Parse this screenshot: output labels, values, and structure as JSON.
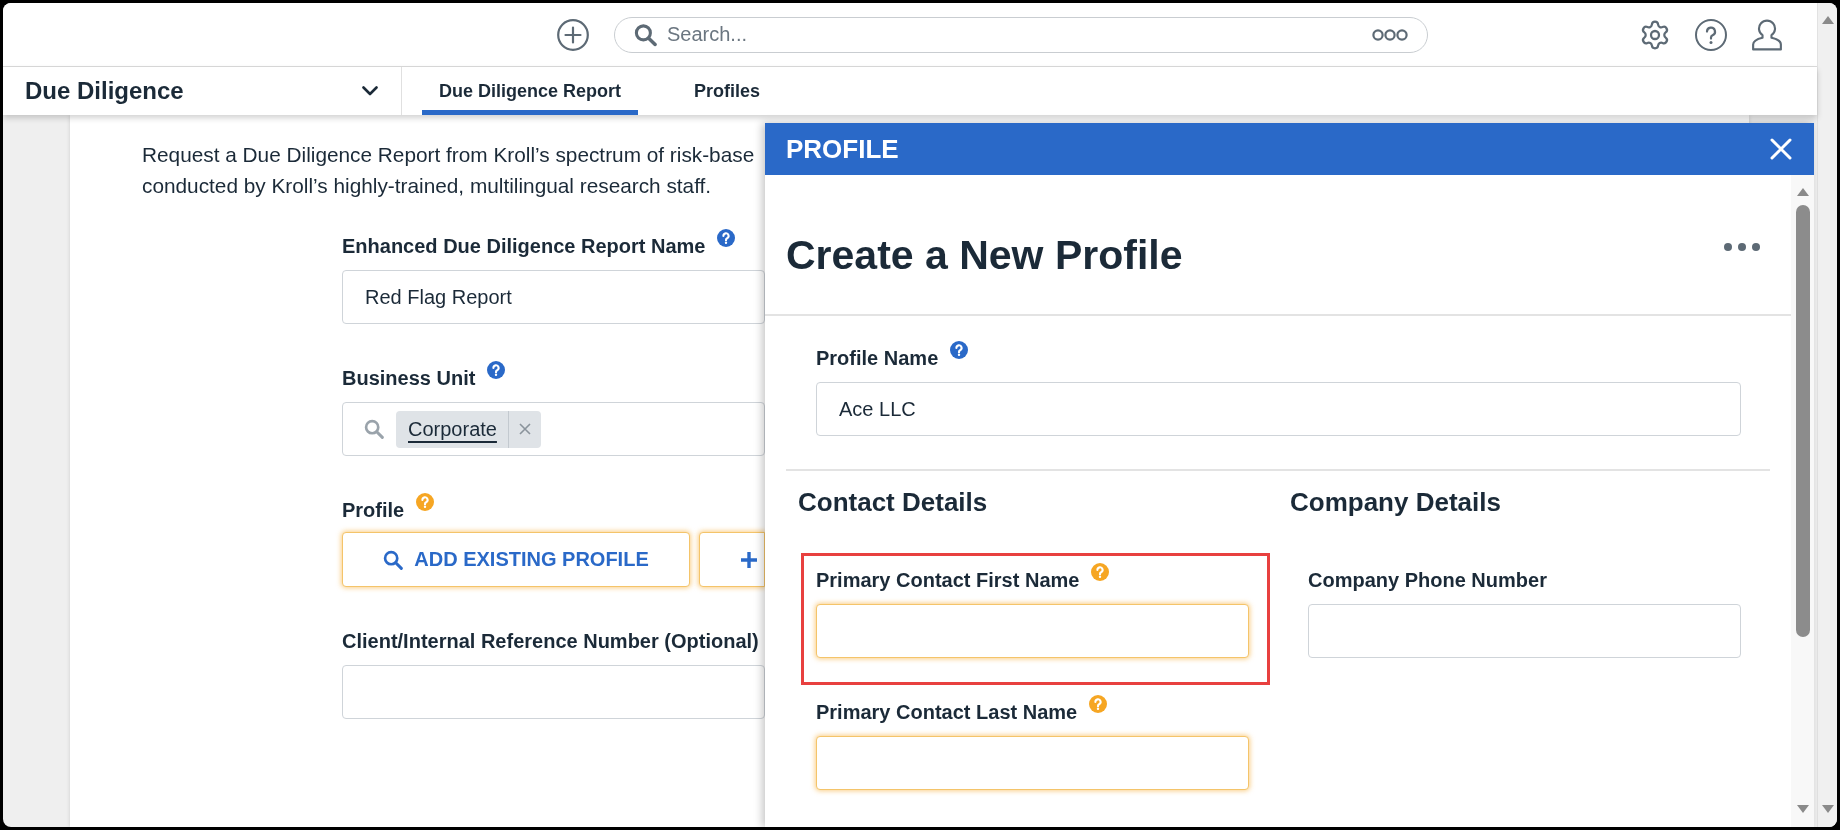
{
  "top_bar": {
    "search": {
      "placeholder": "Search..."
    }
  },
  "nav": {
    "app_name": "Due Diligence",
    "tabs": [
      {
        "label": "Due Diligence Report",
        "selected": true
      },
      {
        "label": "Profiles",
        "selected": false
      }
    ]
  },
  "page": {
    "description_lines": [
      "Request a Due Diligence Report from Kroll’s spectrum of risk-base",
      "conducted by Kroll’s highly-trained, multilingual research staff."
    ],
    "fields": [
      {
        "kind": "text",
        "label": "Enhanced Due Diligence Report Name",
        "help_icon": true,
        "warning": false,
        "value": "Red Flag Report"
      },
      {
        "kind": "tags",
        "label": "Business Unit",
        "help_icon": true,
        "warning": false,
        "tags": [
          "Corporate"
        ]
      },
      {
        "kind": "buttons",
        "label": "Profile",
        "help_icon": true,
        "warning": true,
        "buttons": [
          {
            "kind": "search",
            "label": "ADD EXISTING PROFILE"
          },
          {
            "kind": "add"
          }
        ]
      },
      {
        "kind": "text",
        "label": "Client/Internal Reference Number (Optional)",
        "help_icon": false,
        "warning": false
      }
    ]
  },
  "panel": {
    "header": "PROFILE",
    "title": "Create a New Profile",
    "fields": [
      {
        "label": "Profile Name",
        "help_icon": true,
        "warning": false,
        "value": "Ace LLC"
      }
    ],
    "sections": [
      {
        "heading": "Contact Details",
        "fields": [
          {
            "label": "Primary Contact First Name",
            "help_icon": true,
            "warning": true,
            "highlighted": true
          },
          {
            "label": "Primary Contact Last Name",
            "help_icon": true,
            "warning": true,
            "highlighted": false
          }
        ]
      },
      {
        "heading": "Company Details",
        "fields": [
          {
            "label": "Company Phone Number",
            "help_icon": false,
            "warning": false,
            "highlighted": false
          }
        ]
      }
    ]
  }
}
